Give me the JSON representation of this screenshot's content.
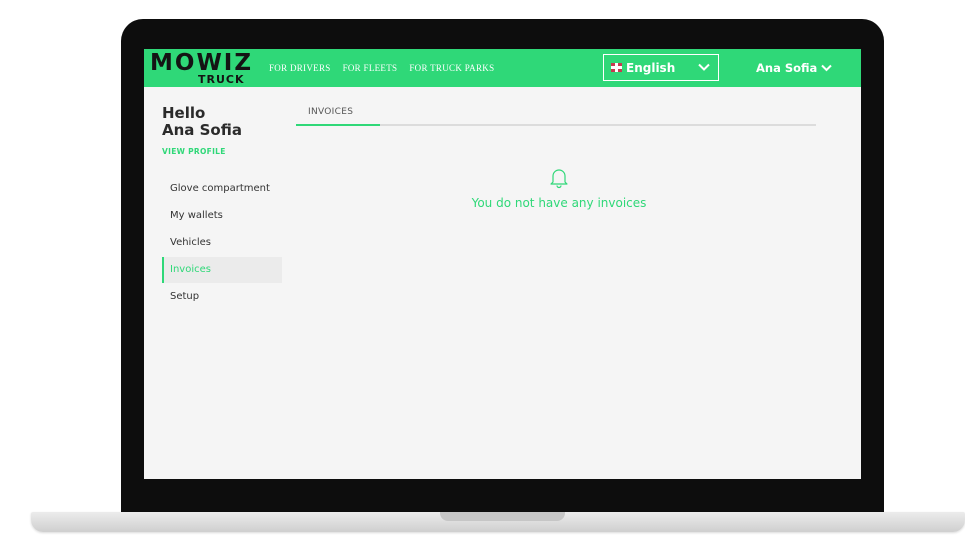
{
  "header": {
    "logo_main": "MOWIZ",
    "logo_sub": "TRUCK",
    "nav": [
      "FOR DRIVERS",
      "FOR FLEETS",
      "FOR TRUCK PARKS"
    ],
    "language": "English",
    "language_flag": "uk-flag-icon",
    "user": "Ana Sofia"
  },
  "sidebar": {
    "greeting_line1": "Hello",
    "greeting_line2": "Ana Sofia",
    "view_profile": "VIEW PROFILE",
    "items": [
      {
        "label": "Glove compartment"
      },
      {
        "label": "My wallets"
      },
      {
        "label": "Vehicles"
      },
      {
        "label": "Invoices",
        "active": true
      },
      {
        "label": "Setup"
      }
    ]
  },
  "main": {
    "tab": "INVOICES",
    "empty_icon": "bell-icon",
    "empty_message": "You do not have any invoices"
  },
  "colors": {
    "accent": "#2fd878",
    "logo_text": "#141414",
    "laptop_frame": "#0d0d0d"
  }
}
